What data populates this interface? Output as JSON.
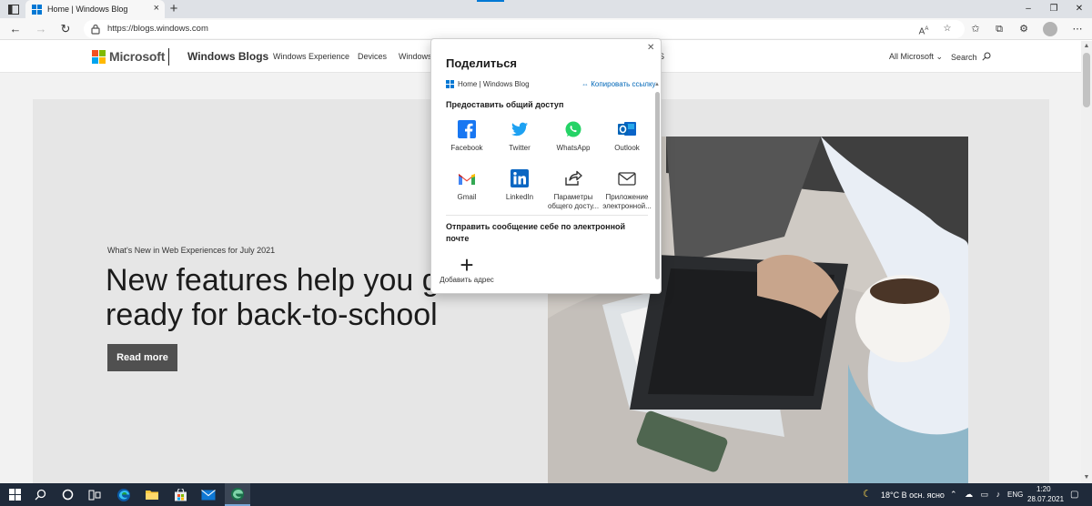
{
  "browser": {
    "tab_title": "Home | Windows Blog",
    "tab_close": "×",
    "new_tab": "+",
    "url": "https://blogs.windows.com",
    "window_controls": {
      "minimize": "–",
      "restore": "❐",
      "close": "✕"
    }
  },
  "site_nav": {
    "brand": "Microsoft",
    "blog_title": "Windows Blogs",
    "links": [
      "Windows Experience",
      "Devices",
      "Windows",
      "S"
    ],
    "all_microsoft": "All Microsoft",
    "search": "Search"
  },
  "hero": {
    "eyebrow": "What's New in Web Experiences for July 2021",
    "headline": "New features help you get ready for back-to-school",
    "cta": "Read more"
  },
  "share": {
    "title": "Поделиться",
    "page_title": "Home | Windows Blog",
    "copy_link": "Копировать ссылку",
    "section_share": "Предоставить общий доступ",
    "items": [
      {
        "label": "Facebook",
        "icon": "facebook-icon"
      },
      {
        "label": "Twitter",
        "icon": "twitter-icon"
      },
      {
        "label": "WhatsApp",
        "icon": "whatsapp-icon"
      },
      {
        "label": "Outlook",
        "icon": "outlook-icon"
      },
      {
        "label": "Gmail",
        "icon": "gmail-icon"
      },
      {
        "label": "LinkedIn",
        "icon": "linkedin-icon"
      },
      {
        "label": "Параметры общего досту...",
        "icon": "share-settings-icon"
      },
      {
        "label": "Приложение электронной...",
        "icon": "mail-icon"
      }
    ],
    "section_email": "Отправить сообщение себе по электронной почте",
    "add_address": "Добавить адрес"
  },
  "taskbar": {
    "weather": "18°C  В осн. ясно",
    "language": "ENG",
    "time": "1:20",
    "date": "28.07.2021"
  },
  "colors": {
    "accent": "#0078d4",
    "taskbar": "#1f2a3a",
    "read_more_bg": "#505050",
    "link": "#0067b8"
  }
}
